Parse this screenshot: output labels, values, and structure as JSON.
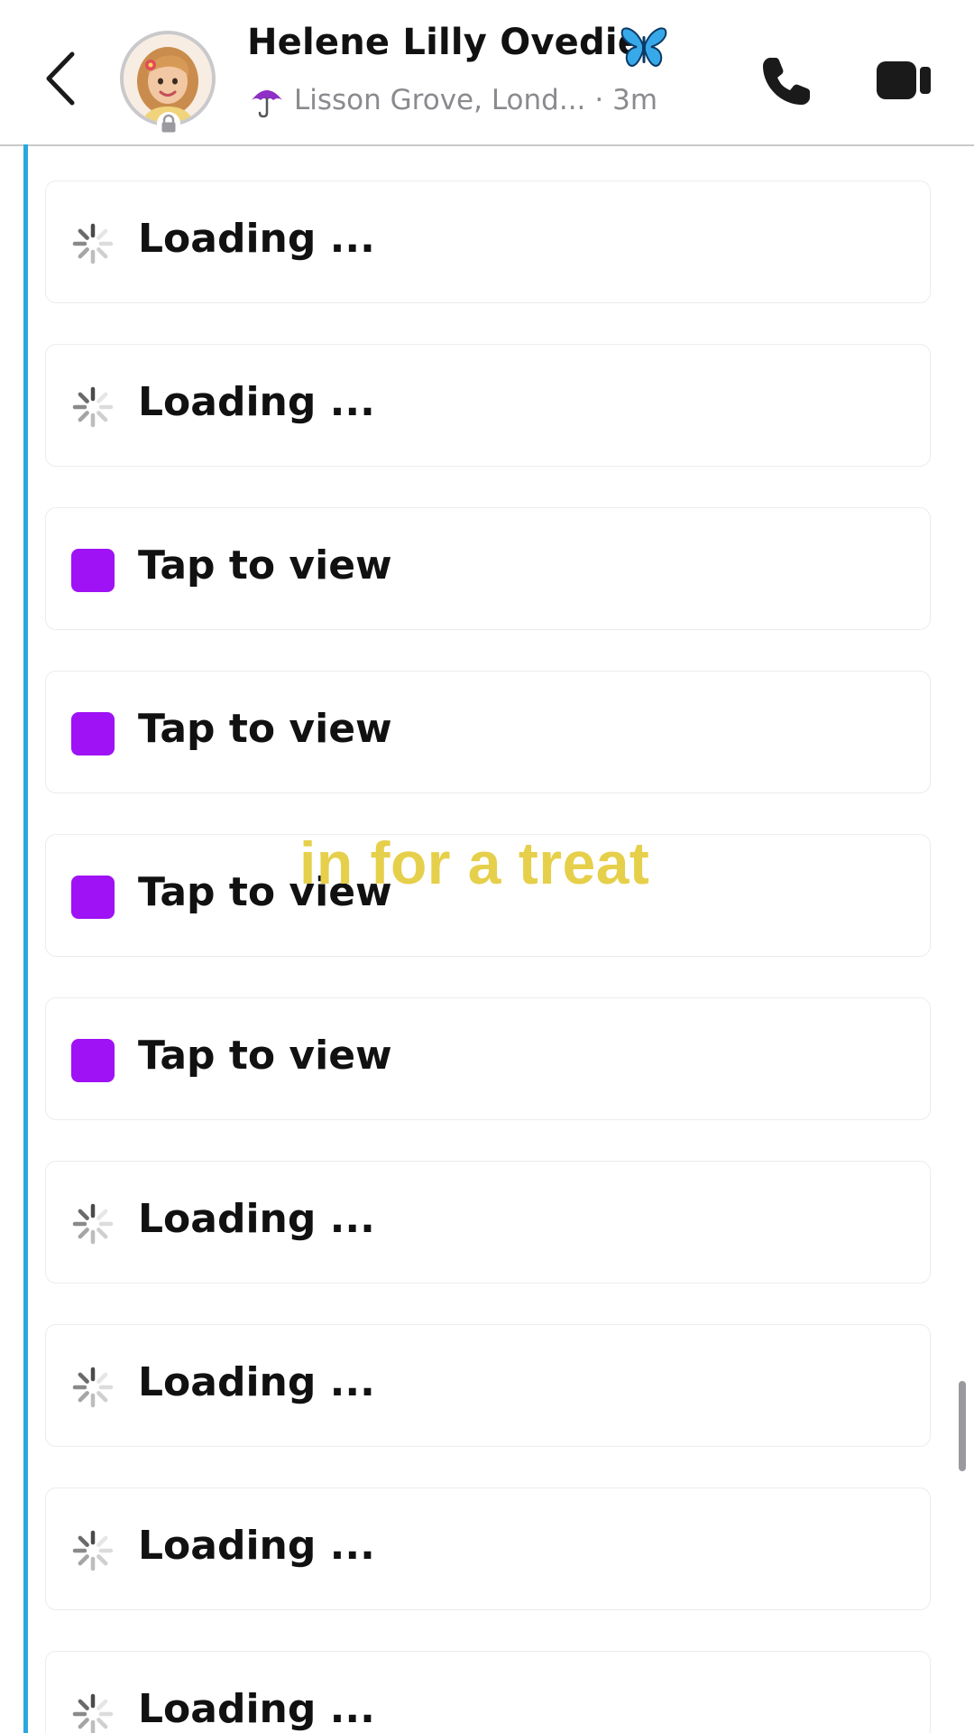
{
  "header": {
    "contact_name": "Helene Lilly Ovedie",
    "name_emoji_icon": "butterfly-icon",
    "location_icon": "umbrella-icon",
    "location": "Lisson Grove, Lond...",
    "last_seen": "· 3m"
  },
  "items": [
    {
      "state": "loading",
      "label": "Loading ..."
    },
    {
      "state": "loading",
      "label": "Loading ..."
    },
    {
      "state": "unopened",
      "label": "Tap to view"
    },
    {
      "state": "unopened",
      "label": "Tap to view"
    },
    {
      "state": "unopened",
      "label": "Tap to view"
    },
    {
      "state": "unopened",
      "label": "Tap to view"
    },
    {
      "state": "loading",
      "label": "Loading ..."
    },
    {
      "state": "loading",
      "label": "Loading ..."
    },
    {
      "state": "loading",
      "label": "Loading ..."
    },
    {
      "state": "loading",
      "label": "Loading ..."
    }
  ],
  "overlay_caption": "in for a treat",
  "colors": {
    "accent_bar": "#2aa7de",
    "snap_square": "#9e12f5",
    "caption": "#e6cf4a"
  }
}
